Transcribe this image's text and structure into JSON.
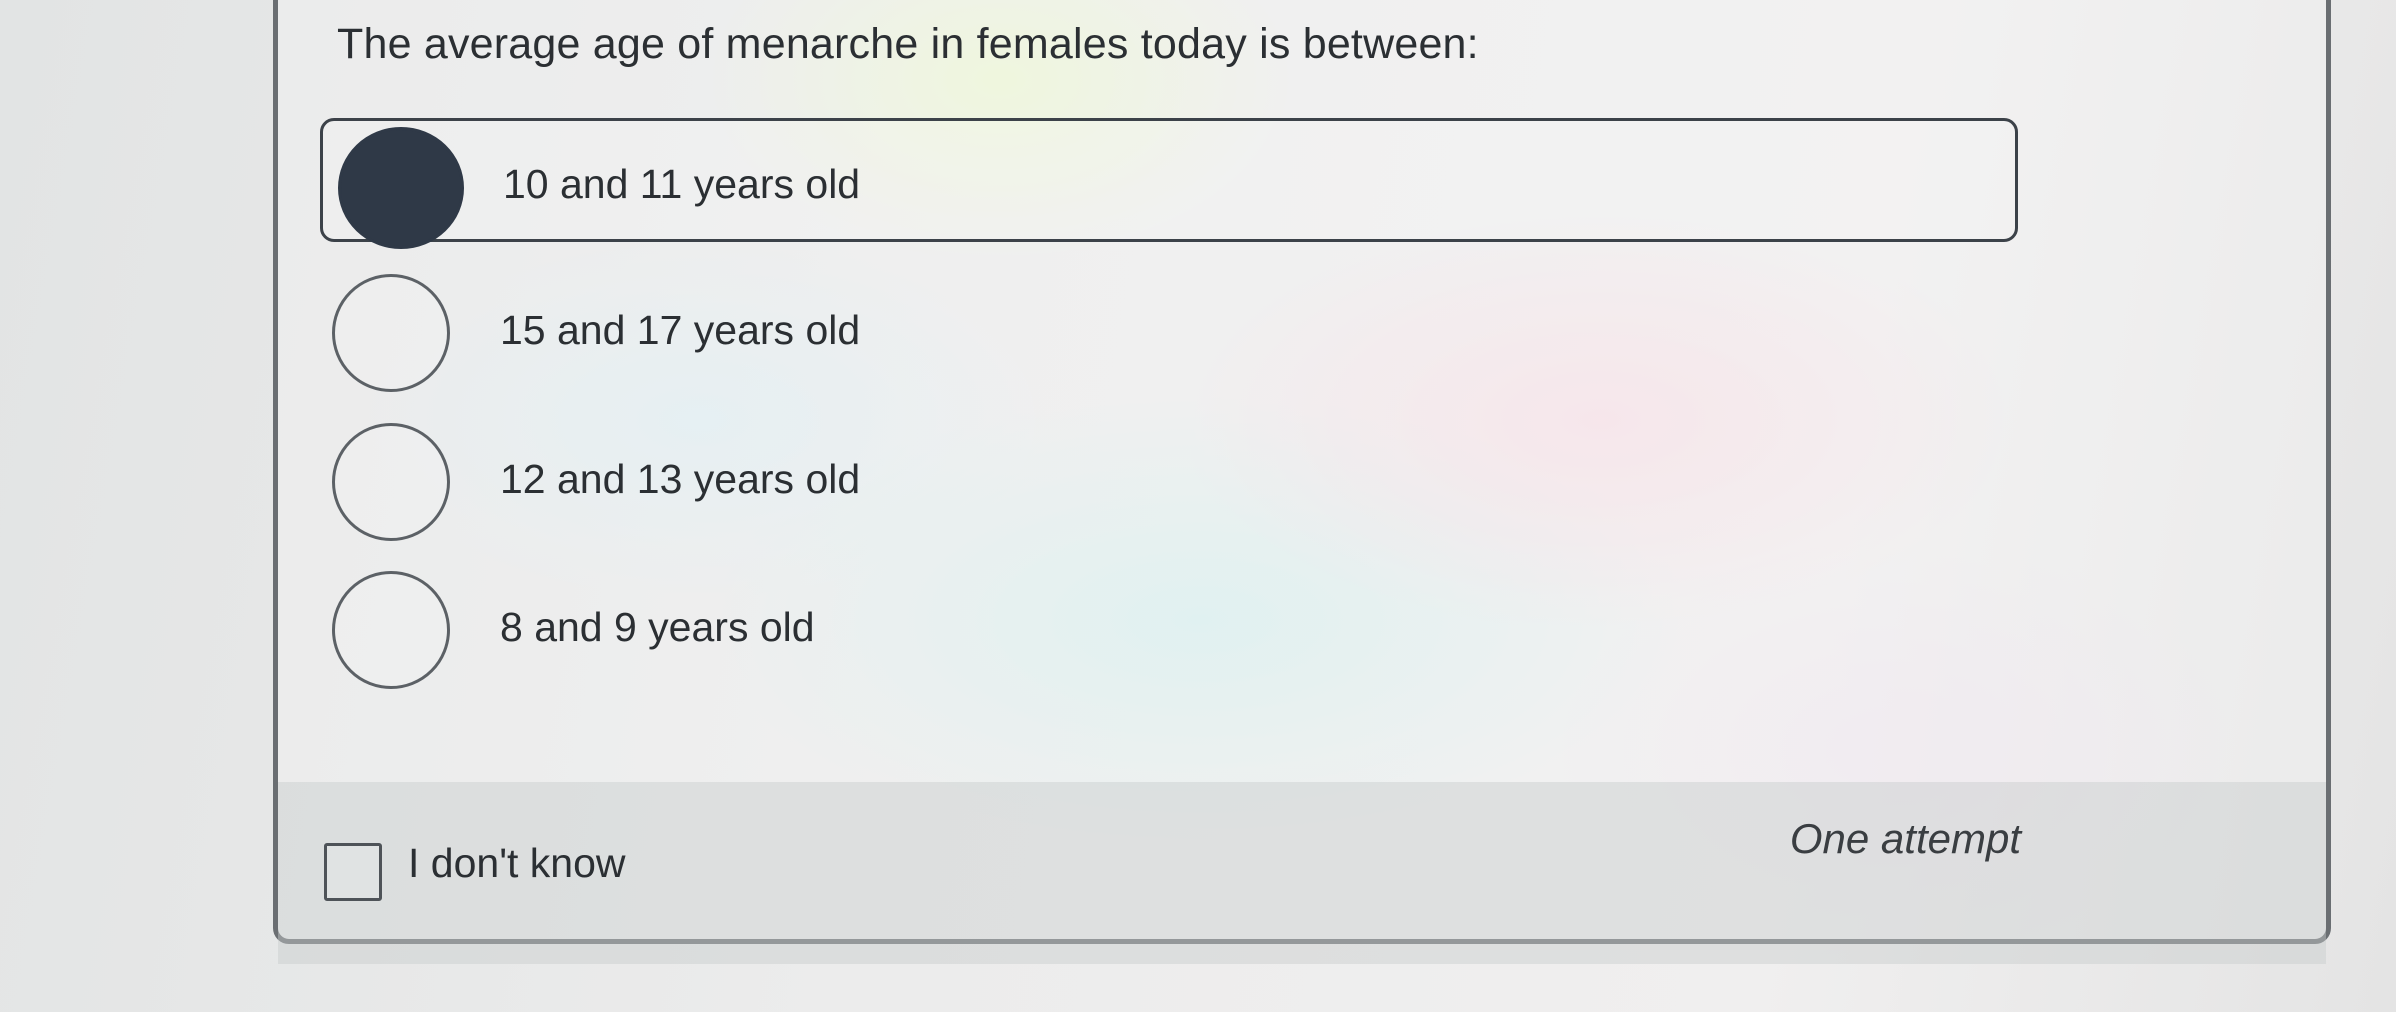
{
  "question": {
    "text": "The average age of menarche in females today is between:"
  },
  "options": [
    {
      "label": "10 and 11 years old",
      "selected": true
    },
    {
      "label": "15 and 17 years old",
      "selected": false
    },
    {
      "label": "12 and 13 years old",
      "selected": false
    },
    {
      "label": "8 and 9 years old",
      "selected": false
    }
  ],
  "footer": {
    "dont_know_label": "I don't know",
    "dont_know_checked": false,
    "attempts_label": "One attempt"
  },
  "colors": {
    "selected_radio": "#2f3947",
    "border": "#6a6e72"
  }
}
